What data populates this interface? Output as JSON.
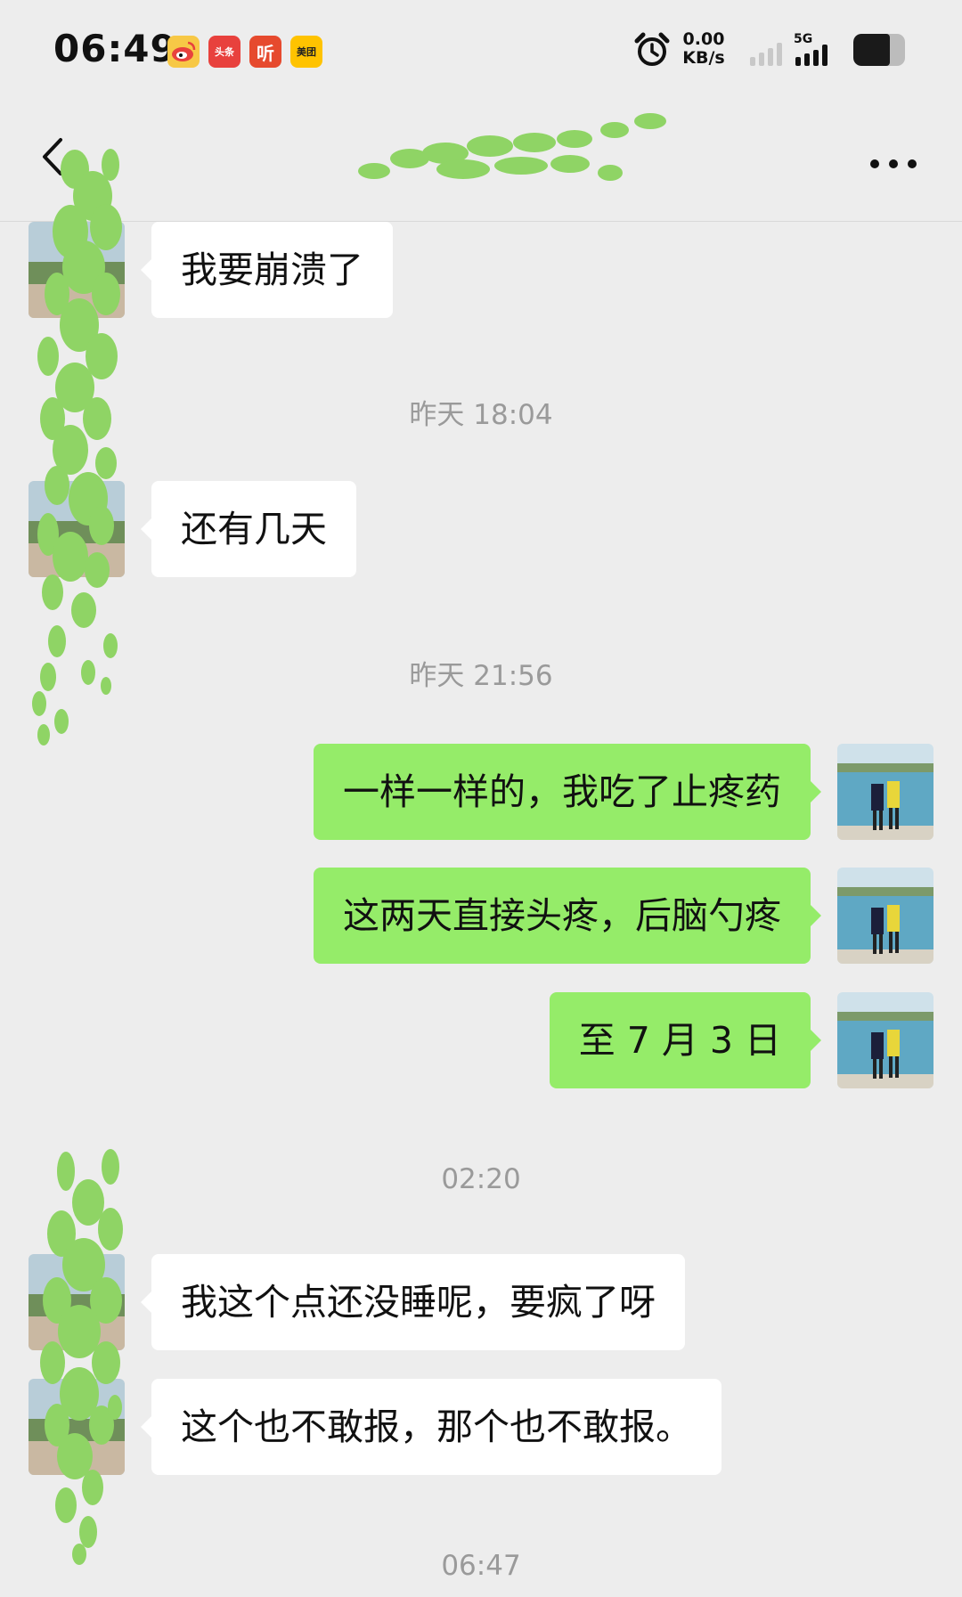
{
  "status_bar": {
    "time": "06:49",
    "app_icons": [
      "weibo-icon",
      "toutiao-icon",
      "ting-icon",
      "meituan-icon"
    ],
    "toutiao_label": "头条",
    "ting_label": "听",
    "meituan_label": "美团",
    "net_speed_value": "0.00",
    "net_speed_unit": "KB/s",
    "network_gen": "5G",
    "battery_level_percent": 70
  },
  "chat": {
    "title": "",
    "messages": [
      {
        "type": "received",
        "text": "我要崩溃了"
      },
      {
        "type": "time",
        "text": "昨天 18:04"
      },
      {
        "type": "received",
        "text": "还有几天"
      },
      {
        "type": "time",
        "text": "昨天 21:56"
      },
      {
        "type": "sent",
        "text": "一样一样的，我吃了止疼药"
      },
      {
        "type": "sent",
        "text": "这两天直接头疼，后脑勺疼"
      },
      {
        "type": "sent",
        "text": "至 7 月 3 日"
      },
      {
        "type": "time",
        "text": "02:20"
      },
      {
        "type": "received",
        "text": "我这个点还没睡呢，要疯了呀"
      },
      {
        "type": "received",
        "text": "这个也不敢报，那个也不敢报。"
      },
      {
        "type": "time",
        "text": "06:47"
      }
    ]
  },
  "colors": {
    "background": "#ededed",
    "sent_bubble": "#95ec69",
    "received_bubble": "#ffffff",
    "redaction": "#8fd465",
    "timestamp": "#9a9a9a"
  }
}
